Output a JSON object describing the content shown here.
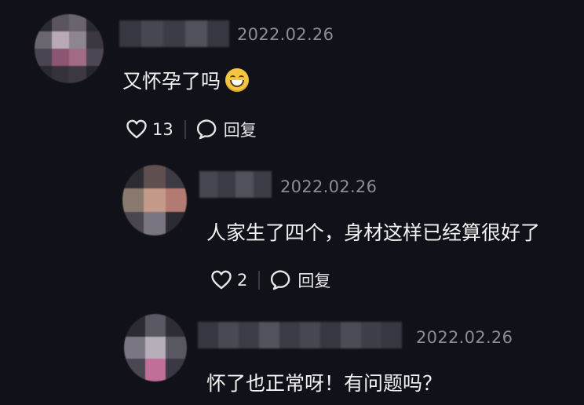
{
  "comments": [
    {
      "date": "2022.02.26",
      "text": "又怀孕了吗",
      "emoji": "grinning-face-emoji",
      "likes": "13",
      "reply_label": "回复"
    },
    {
      "date": "2022.02.26",
      "text": "人家生了四个，身材这样已经算很好了",
      "likes": "2",
      "reply_label": "回复"
    },
    {
      "date": "2022.02.26",
      "text": "怀了也正常呀！有问题吗？"
    }
  ],
  "colors": {
    "background": "#111119",
    "date": "#8c8c92",
    "text": "#f2f2f2"
  }
}
